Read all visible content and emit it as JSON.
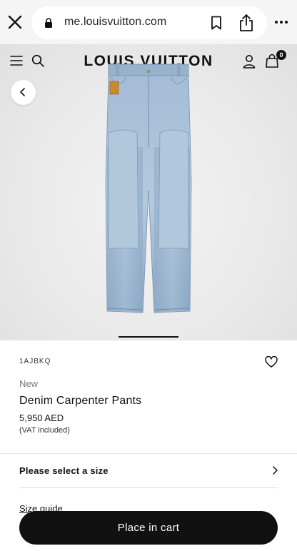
{
  "browser": {
    "url": "me.louisvuitton.com",
    "icons": [
      "close-icon",
      "lock-icon",
      "bookmark-icon",
      "share-icon",
      "more-icon"
    ]
  },
  "header": {
    "brand": "LOUIS VUITTON",
    "cart_count": "0",
    "icons": [
      "menu-icon",
      "search-icon",
      "account-icon",
      "shopping-bag-icon"
    ]
  },
  "gallery": {
    "icons": [
      "chevron-left-icon"
    ]
  },
  "product": {
    "sku": "1AJBKQ",
    "badge": "New",
    "name": "Denim Carpenter Pants",
    "price": "5,950 AED",
    "vat_note": "(VAT included)"
  },
  "size": {
    "label": "Please select a size",
    "guide": "Size guide"
  },
  "cta": {
    "label": "Place in cart"
  },
  "colors": {
    "primary": "#111111",
    "denim": "#9db8d3",
    "muted_text": "#757575"
  }
}
